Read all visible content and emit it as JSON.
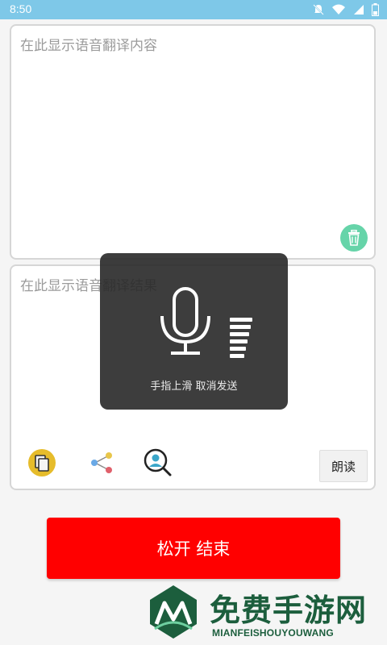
{
  "status_bar": {
    "time": "8:50",
    "icons": [
      "notifications-off-icon",
      "wifi-icon",
      "signal-icon",
      "battery-icon"
    ]
  },
  "source_panel": {
    "placeholder": "在此显示语音翻译内容",
    "delete_icon": "trash-icon"
  },
  "result_panel": {
    "placeholder": "在此显示语音翻译结果",
    "tools": [
      "copy-icon",
      "share-icon",
      "search-person-icon"
    ],
    "read_label": "朗读"
  },
  "recording_overlay": {
    "icon": "microphone-icon",
    "hint": "手指上滑 取消发送"
  },
  "main_button": {
    "label": "松开 结束"
  },
  "watermark": {
    "title": "免费手游网",
    "subtitle": "MIANFEISHOUYOUWANG"
  },
  "colors": {
    "status_bar": "#7ec8e8",
    "primary": "#ff0000",
    "trash": "#66d4a9",
    "watermark": "#1c5e3d"
  }
}
